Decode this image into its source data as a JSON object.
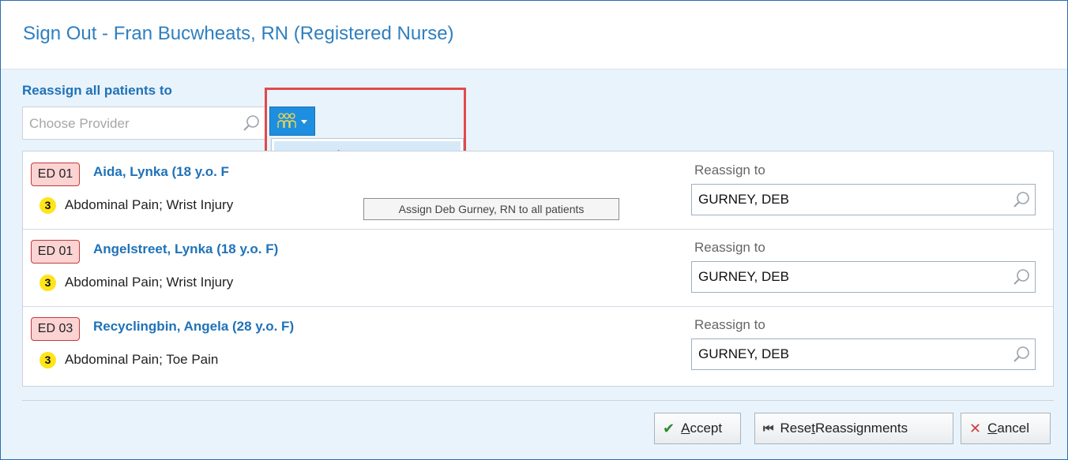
{
  "dialog": {
    "title": "Sign Out - Fran Bucwheats, RN (Registered Nurse)"
  },
  "reassign_all": {
    "label": "Reassign all patients to",
    "placeholder": "Choose Provider",
    "team_button_icon": "care-team-icon",
    "dropdown_items": [
      "Deb Gurney, RN"
    ],
    "tooltip": "Assign Deb Gurney, RN to all patients"
  },
  "patients": [
    {
      "location": "ED 01",
      "name": "Aida, Lynka (18 y.o. F",
      "acuity": "3",
      "complaint": "Abdominal Pain; Wrist Injury",
      "reassign_label": "Reassign to",
      "reassign_value": "GURNEY, DEB"
    },
    {
      "location": "ED 01",
      "name": "Angelstreet, Lynka (18 y.o. F)",
      "acuity": "3",
      "complaint": "Abdominal Pain; Wrist Injury",
      "reassign_label": "Reassign to",
      "reassign_value": "GURNEY, DEB"
    },
    {
      "location": "ED 03",
      "name": "Recyclingbin, Angela (28 y.o. F)",
      "acuity": "3",
      "complaint": "Abdominal Pain; Toe Pain",
      "reassign_label": "Reassign to",
      "reassign_value": "GURNEY, DEB"
    }
  ],
  "footer": {
    "accept": {
      "pre": "",
      "key": "A",
      "post": "ccept"
    },
    "reset": {
      "pre": "Rese",
      "key": "t",
      "post": " Reassignments"
    },
    "cancel": {
      "pre": "",
      "key": "C",
      "post": "ancel"
    }
  },
  "colors": {
    "accent": "#1f72b8",
    "highlight": "#e04a4a",
    "badge_bg": "#fbd3d3",
    "acuity": "#ffe41a"
  }
}
